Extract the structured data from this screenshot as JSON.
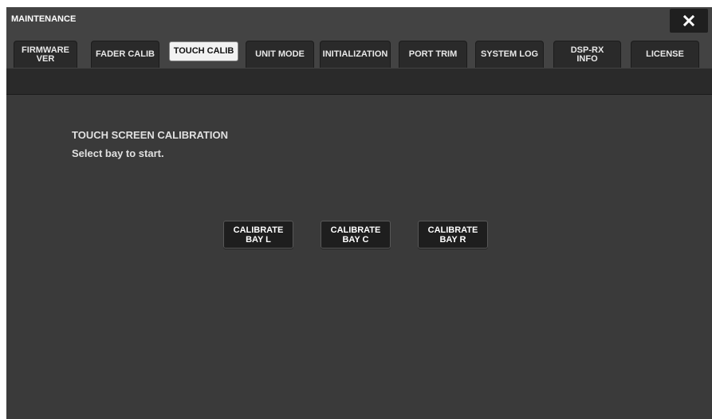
{
  "window": {
    "title": "MAINTENANCE",
    "close_icon": "close-x-icon"
  },
  "tabs": [
    {
      "label": "FIRMWARE\nVER",
      "active": false
    },
    {
      "label": "FADER CALIB",
      "active": false
    },
    {
      "label": "TOUCH CALIB",
      "active": true
    },
    {
      "label": "UNIT MODE",
      "active": false
    },
    {
      "label": "INITIALIZATION",
      "active": false
    },
    {
      "label": "PORT TRIM",
      "active": false
    },
    {
      "label": "SYSTEM LOG",
      "active": false
    },
    {
      "label": "DSP-RX\nINFO",
      "active": false
    },
    {
      "label": "LICENSE",
      "active": false
    }
  ],
  "content": {
    "heading": "TOUCH SCREEN CALIBRATION",
    "instruction": "Select bay to start.",
    "buttons": [
      {
        "label": "CALIBRATE\nBAY L"
      },
      {
        "label": "CALIBRATE\nBAY C"
      },
      {
        "label": "CALIBRATE\nBAY R"
      }
    ]
  },
  "colors": {
    "window_bg": "#3a3a3a",
    "titlebar_bg": "#434343",
    "tab_bg": "#2a2a2a",
    "tab_active_bg": "#f2f2f2",
    "button_bg": "#1e1e1e"
  }
}
